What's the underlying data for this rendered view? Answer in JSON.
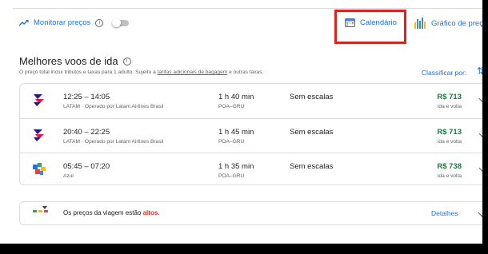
{
  "monitor": {
    "label": "Monitorar preços",
    "enabled": false
  },
  "toolbar": {
    "calendar_label": "Calendário",
    "graph_label": "Gráfico de preços"
  },
  "section": {
    "title": "Melhores voos de ida",
    "note_prefix": "O preço total inclui tributos e taxas para 1 adulto. Sujeito a ",
    "note_link": "tarifas adicionais de bagagem",
    "note_suffix": " e outras taxas.",
    "sort_label": "Classificar por:"
  },
  "flights": [
    {
      "times": "12:25 – 14:05",
      "airline": "LATAM · Operado por Latam Airlines Brasil",
      "duration": "1 h 40 min",
      "route": "POA–GRU",
      "stops": "Sem escalas",
      "price": "R$ 713",
      "price_type": "ida e volta",
      "logo": "latam-logo"
    },
    {
      "times": "20:40 – 22:25",
      "airline": "LATAM · Operado por Latam Airlines Brasil",
      "duration": "1 h 45 min",
      "route": "POA–GRU",
      "stops": "Sem escalas",
      "price": "R$ 713",
      "price_type": "ida e volta",
      "logo": "latam-logo"
    },
    {
      "times": "05:45 – 07:20",
      "airline": "Azul",
      "duration": "1 h 35 min",
      "route": "POA–GRU",
      "stops": "Sem escalas",
      "price": "R$ 738",
      "price_type": "ida e volta",
      "logo": "azul-logo"
    }
  ],
  "insight": {
    "prefix": "Os preços da viagem estão ",
    "level": "altos",
    "suffix": ".",
    "details_label": "Detalhes"
  },
  "colors": {
    "accent": "#1a73e8",
    "price_green": "#188038",
    "alert_red": "#d93025",
    "highlight_box": "#e02020"
  }
}
